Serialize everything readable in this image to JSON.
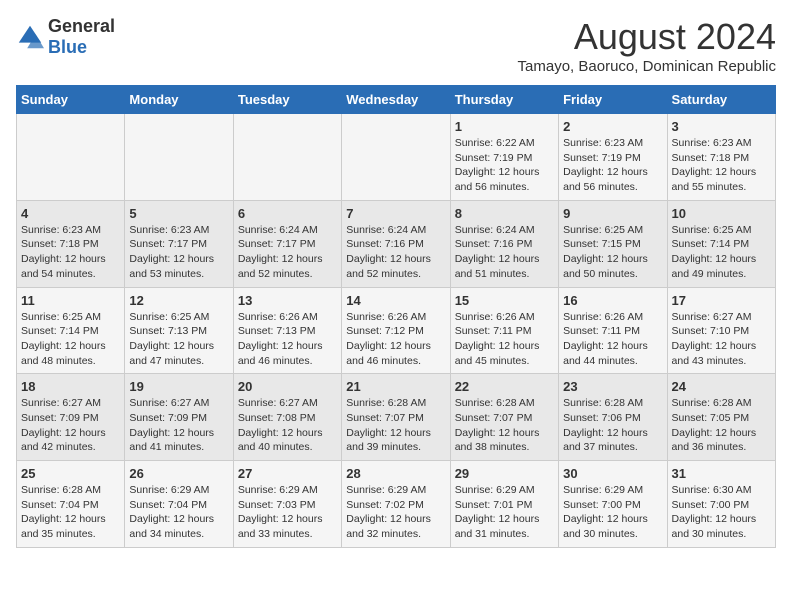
{
  "logo": {
    "general": "General",
    "blue": "Blue"
  },
  "title": "August 2024",
  "subtitle": "Tamayo, Baoruco, Dominican Republic",
  "days_header": [
    "Sunday",
    "Monday",
    "Tuesday",
    "Wednesday",
    "Thursday",
    "Friday",
    "Saturday"
  ],
  "weeks": [
    [
      {
        "day": "",
        "info": ""
      },
      {
        "day": "",
        "info": ""
      },
      {
        "day": "",
        "info": ""
      },
      {
        "day": "",
        "info": ""
      },
      {
        "day": "1",
        "info": "Sunrise: 6:22 AM\nSunset: 7:19 PM\nDaylight: 12 hours and 56 minutes."
      },
      {
        "day": "2",
        "info": "Sunrise: 6:23 AM\nSunset: 7:19 PM\nDaylight: 12 hours and 56 minutes."
      },
      {
        "day": "3",
        "info": "Sunrise: 6:23 AM\nSunset: 7:18 PM\nDaylight: 12 hours and 55 minutes."
      }
    ],
    [
      {
        "day": "4",
        "info": "Sunrise: 6:23 AM\nSunset: 7:18 PM\nDaylight: 12 hours and 54 minutes."
      },
      {
        "day": "5",
        "info": "Sunrise: 6:23 AM\nSunset: 7:17 PM\nDaylight: 12 hours and 53 minutes."
      },
      {
        "day": "6",
        "info": "Sunrise: 6:24 AM\nSunset: 7:17 PM\nDaylight: 12 hours and 52 minutes."
      },
      {
        "day": "7",
        "info": "Sunrise: 6:24 AM\nSunset: 7:16 PM\nDaylight: 12 hours and 52 minutes."
      },
      {
        "day": "8",
        "info": "Sunrise: 6:24 AM\nSunset: 7:16 PM\nDaylight: 12 hours and 51 minutes."
      },
      {
        "day": "9",
        "info": "Sunrise: 6:25 AM\nSunset: 7:15 PM\nDaylight: 12 hours and 50 minutes."
      },
      {
        "day": "10",
        "info": "Sunrise: 6:25 AM\nSunset: 7:14 PM\nDaylight: 12 hours and 49 minutes."
      }
    ],
    [
      {
        "day": "11",
        "info": "Sunrise: 6:25 AM\nSunset: 7:14 PM\nDaylight: 12 hours and 48 minutes."
      },
      {
        "day": "12",
        "info": "Sunrise: 6:25 AM\nSunset: 7:13 PM\nDaylight: 12 hours and 47 minutes."
      },
      {
        "day": "13",
        "info": "Sunrise: 6:26 AM\nSunset: 7:13 PM\nDaylight: 12 hours and 46 minutes."
      },
      {
        "day": "14",
        "info": "Sunrise: 6:26 AM\nSunset: 7:12 PM\nDaylight: 12 hours and 46 minutes."
      },
      {
        "day": "15",
        "info": "Sunrise: 6:26 AM\nSunset: 7:11 PM\nDaylight: 12 hours and 45 minutes."
      },
      {
        "day": "16",
        "info": "Sunrise: 6:26 AM\nSunset: 7:11 PM\nDaylight: 12 hours and 44 minutes."
      },
      {
        "day": "17",
        "info": "Sunrise: 6:27 AM\nSunset: 7:10 PM\nDaylight: 12 hours and 43 minutes."
      }
    ],
    [
      {
        "day": "18",
        "info": "Sunrise: 6:27 AM\nSunset: 7:09 PM\nDaylight: 12 hours and 42 minutes."
      },
      {
        "day": "19",
        "info": "Sunrise: 6:27 AM\nSunset: 7:09 PM\nDaylight: 12 hours and 41 minutes."
      },
      {
        "day": "20",
        "info": "Sunrise: 6:27 AM\nSunset: 7:08 PM\nDaylight: 12 hours and 40 minutes."
      },
      {
        "day": "21",
        "info": "Sunrise: 6:28 AM\nSunset: 7:07 PM\nDaylight: 12 hours and 39 minutes."
      },
      {
        "day": "22",
        "info": "Sunrise: 6:28 AM\nSunset: 7:07 PM\nDaylight: 12 hours and 38 minutes."
      },
      {
        "day": "23",
        "info": "Sunrise: 6:28 AM\nSunset: 7:06 PM\nDaylight: 12 hours and 37 minutes."
      },
      {
        "day": "24",
        "info": "Sunrise: 6:28 AM\nSunset: 7:05 PM\nDaylight: 12 hours and 36 minutes."
      }
    ],
    [
      {
        "day": "25",
        "info": "Sunrise: 6:28 AM\nSunset: 7:04 PM\nDaylight: 12 hours and 35 minutes."
      },
      {
        "day": "26",
        "info": "Sunrise: 6:29 AM\nSunset: 7:04 PM\nDaylight: 12 hours and 34 minutes."
      },
      {
        "day": "27",
        "info": "Sunrise: 6:29 AM\nSunset: 7:03 PM\nDaylight: 12 hours and 33 minutes."
      },
      {
        "day": "28",
        "info": "Sunrise: 6:29 AM\nSunset: 7:02 PM\nDaylight: 12 hours and 32 minutes."
      },
      {
        "day": "29",
        "info": "Sunrise: 6:29 AM\nSunset: 7:01 PM\nDaylight: 12 hours and 31 minutes."
      },
      {
        "day": "30",
        "info": "Sunrise: 6:29 AM\nSunset: 7:00 PM\nDaylight: 12 hours and 30 minutes."
      },
      {
        "day": "31",
        "info": "Sunrise: 6:30 AM\nSunset: 7:00 PM\nDaylight: 12 hours and 30 minutes."
      }
    ]
  ]
}
